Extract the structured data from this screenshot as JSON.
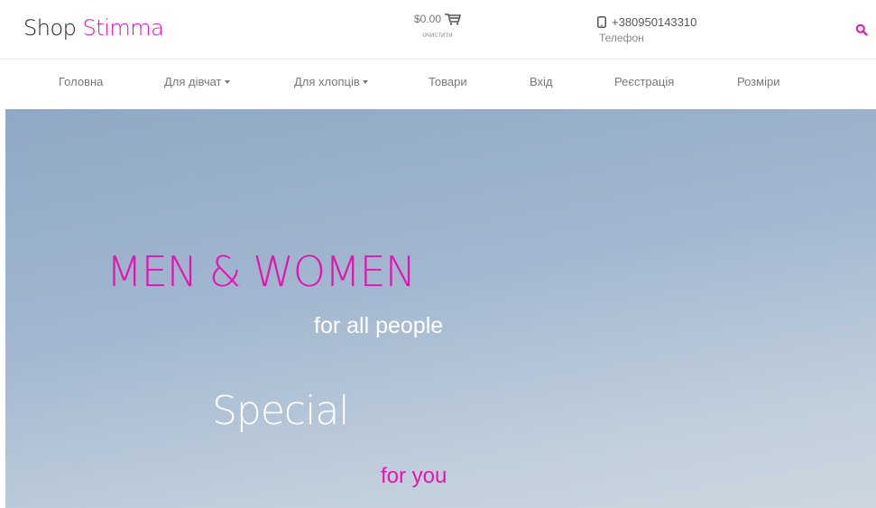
{
  "brand": {
    "part1": "Shop",
    "part2": "Stimma",
    "accent_color": "#e514b0"
  },
  "cart": {
    "total": "$0.00",
    "clear_label": "очистити",
    "icon": "cart-icon"
  },
  "contact": {
    "phone": "+380950143310",
    "label": "Телефон",
    "icon": "mobile-phone-icon"
  },
  "search": {
    "icon": "search-icon"
  },
  "nav": {
    "items": [
      {
        "label": "Головна"
      },
      {
        "label": "Для дівчат"
      },
      {
        "label": "Для хлопців"
      },
      {
        "label": "Товари"
      },
      {
        "label": "Вхід"
      },
      {
        "label": "Реєстрація"
      },
      {
        "label": "Розміри"
      }
    ]
  },
  "hero": {
    "title": "MEN & WOMEN",
    "subtitle": "for all people",
    "special": "Special",
    "special_sub": "for you"
  }
}
